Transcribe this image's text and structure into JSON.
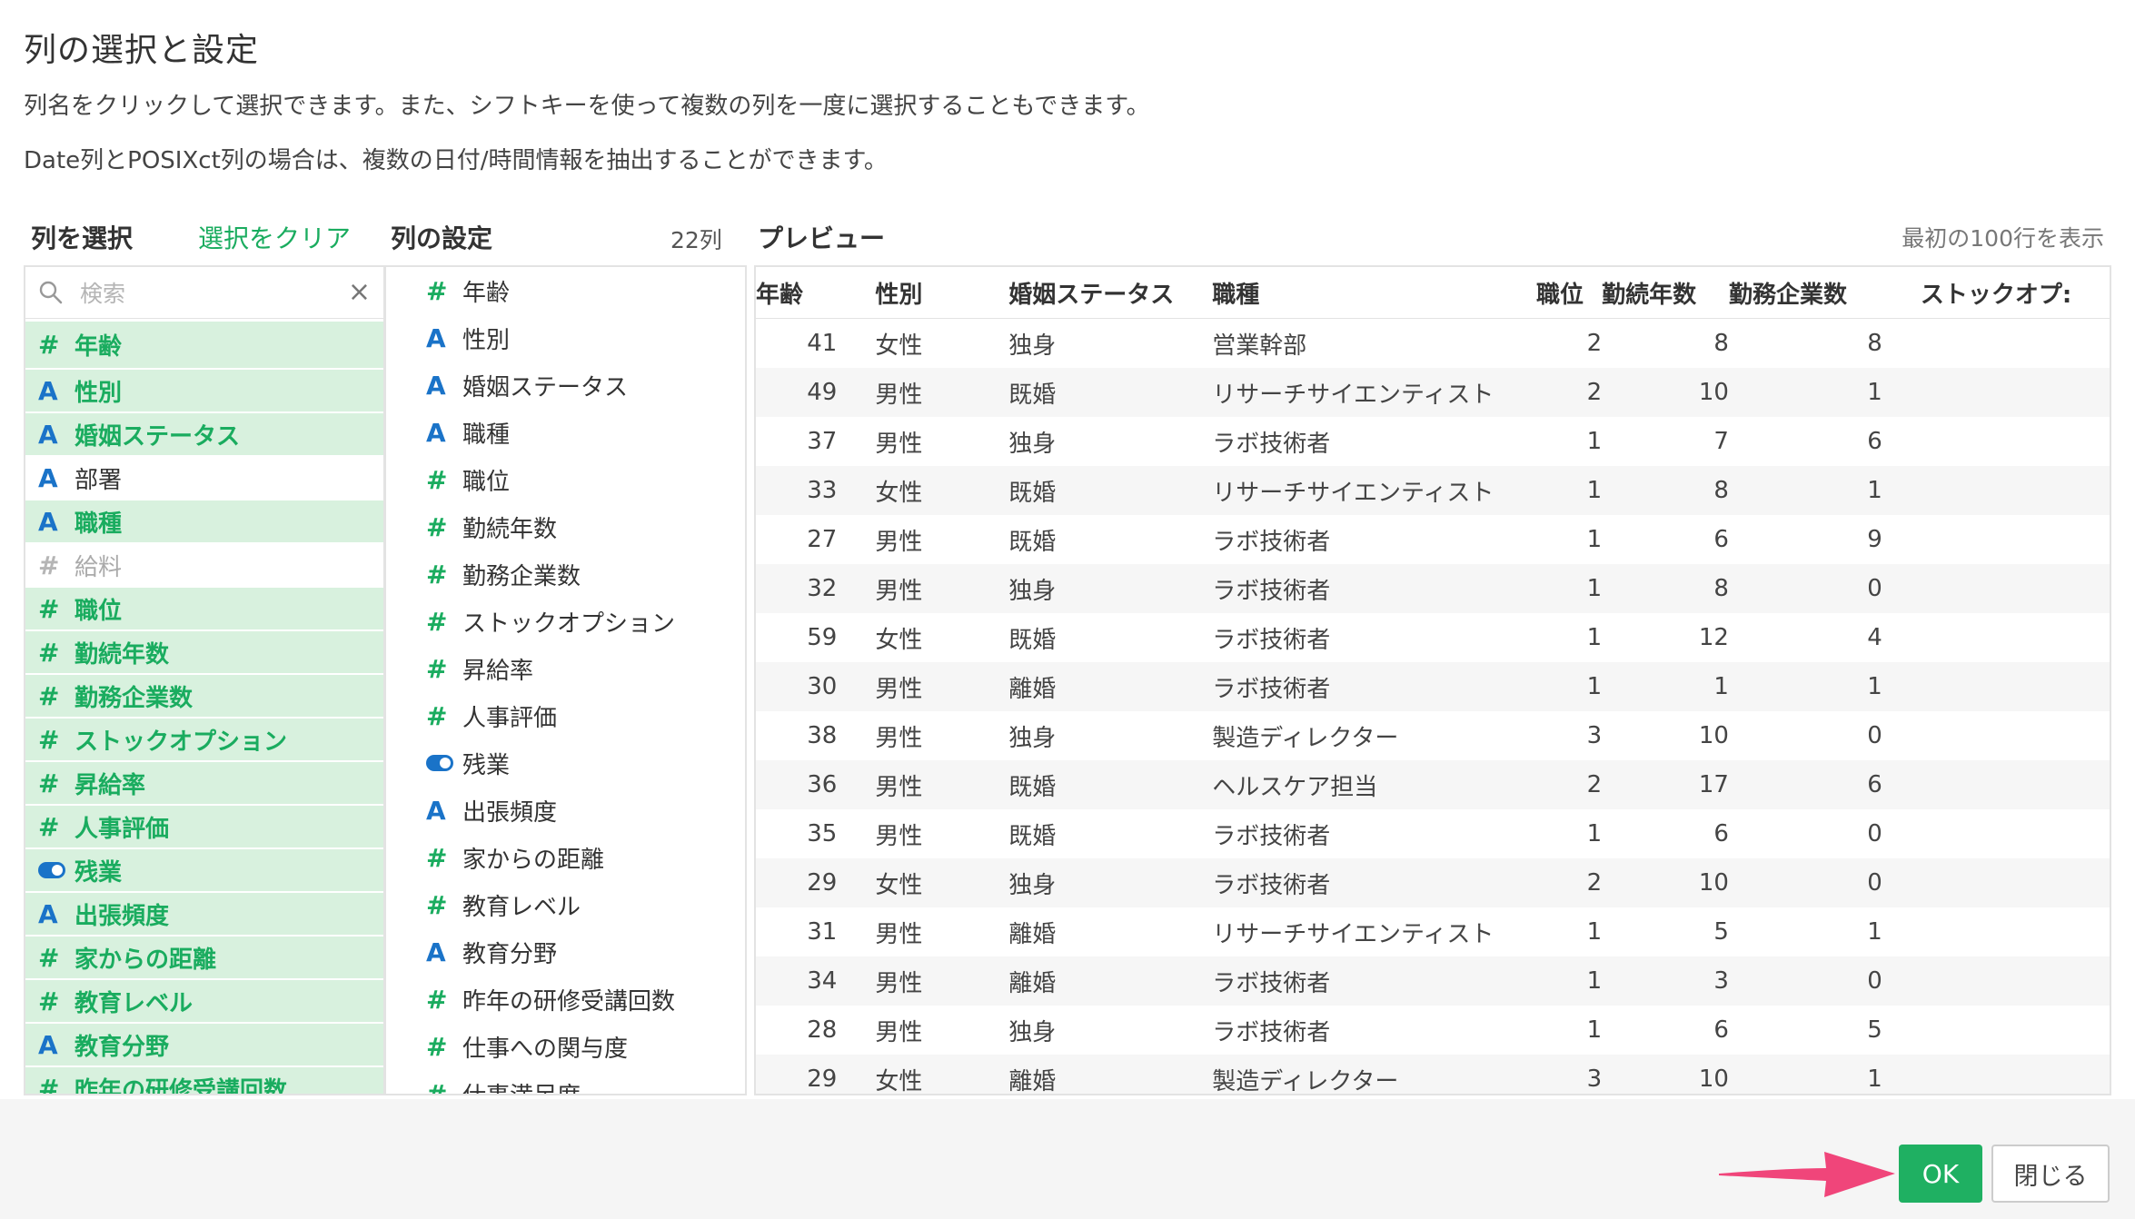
{
  "dialog": {
    "title": "列の選択と設定",
    "description1": "列名をクリックして選択できます。また、シフトキーを使って複数の列を一度に選択することもできます。",
    "description2": "Date列とPOSIXct列の場合は、複数の日付/時間情報を抽出することができます。"
  },
  "select_section": {
    "heading": "列を選択",
    "clear_label": "選択をクリア",
    "search_placeholder": "検索",
    "clear_icon": "×",
    "items": [
      {
        "type": "#",
        "label": "年齢",
        "state": "selected"
      },
      {
        "type": "A",
        "label": "性別",
        "state": "selected"
      },
      {
        "type": "A",
        "label": "婚姻ステータス",
        "state": "selected"
      },
      {
        "type": "A",
        "label": "部署",
        "state": "plain"
      },
      {
        "type": "A",
        "label": "職種",
        "state": "selected"
      },
      {
        "type": "#",
        "label": "給料",
        "state": "disabled"
      },
      {
        "type": "#",
        "label": "職位",
        "state": "selected"
      },
      {
        "type": "#",
        "label": "勤続年数",
        "state": "selected"
      },
      {
        "type": "#",
        "label": "勤務企業数",
        "state": "selected"
      },
      {
        "type": "#",
        "label": "ストックオプション",
        "state": "selected"
      },
      {
        "type": "#",
        "label": "昇給率",
        "state": "selected"
      },
      {
        "type": "#",
        "label": "人事評価",
        "state": "selected"
      },
      {
        "type": "toggle",
        "label": "残業",
        "state": "selected"
      },
      {
        "type": "A",
        "label": "出張頻度",
        "state": "selected"
      },
      {
        "type": "#",
        "label": "家からの距離",
        "state": "selected"
      },
      {
        "type": "#",
        "label": "教育レベル",
        "state": "selected"
      },
      {
        "type": "A",
        "label": "教育分野",
        "state": "selected"
      },
      {
        "type": "#",
        "label": "昨年の研修受講回数",
        "state": "selected"
      }
    ]
  },
  "settings_section": {
    "heading": "列の設定",
    "count_label": "22列",
    "items": [
      {
        "type": "#",
        "label": "年齢"
      },
      {
        "type": "A",
        "label": "性別"
      },
      {
        "type": "A",
        "label": "婚姻ステータス"
      },
      {
        "type": "A",
        "label": "職種"
      },
      {
        "type": "#",
        "label": "職位"
      },
      {
        "type": "#",
        "label": "勤続年数"
      },
      {
        "type": "#",
        "label": "勤務企業数"
      },
      {
        "type": "#",
        "label": "ストックオプション"
      },
      {
        "type": "#",
        "label": "昇給率"
      },
      {
        "type": "#",
        "label": "人事評価"
      },
      {
        "type": "toggle",
        "label": "残業"
      },
      {
        "type": "A",
        "label": "出張頻度"
      },
      {
        "type": "#",
        "label": "家からの距離"
      },
      {
        "type": "#",
        "label": "教育レベル"
      },
      {
        "type": "A",
        "label": "教育分野"
      },
      {
        "type": "#",
        "label": "昨年の研修受講回数"
      },
      {
        "type": "#",
        "label": "仕事への関与度"
      },
      {
        "type": "#",
        "label": "仕事満足度"
      }
    ]
  },
  "preview": {
    "heading": "プレビュー",
    "note": "最初の100行を表示",
    "columns": [
      "年齢",
      "性別",
      "婚姻ステータス",
      "職種",
      "職位",
      "勤続年数",
      "勤務企業数",
      "ストックオプ:"
    ],
    "rows": [
      [
        "41",
        "女性",
        "独身",
        "営業幹部",
        "2",
        "8",
        "8",
        ""
      ],
      [
        "49",
        "男性",
        "既婚",
        "リサーチサイエンティスト",
        "2",
        "10",
        "1",
        ""
      ],
      [
        "37",
        "男性",
        "独身",
        "ラボ技術者",
        "1",
        "7",
        "6",
        ""
      ],
      [
        "33",
        "女性",
        "既婚",
        "リサーチサイエンティスト",
        "1",
        "8",
        "1",
        ""
      ],
      [
        "27",
        "男性",
        "既婚",
        "ラボ技術者",
        "1",
        "6",
        "9",
        ""
      ],
      [
        "32",
        "男性",
        "独身",
        "ラボ技術者",
        "1",
        "8",
        "0",
        ""
      ],
      [
        "59",
        "女性",
        "既婚",
        "ラボ技術者",
        "1",
        "12",
        "4",
        ""
      ],
      [
        "30",
        "男性",
        "離婚",
        "ラボ技術者",
        "1",
        "1",
        "1",
        ""
      ],
      [
        "38",
        "男性",
        "独身",
        "製造ディレクター",
        "3",
        "10",
        "0",
        ""
      ],
      [
        "36",
        "男性",
        "既婚",
        "ヘルスケア担当",
        "2",
        "17",
        "6",
        ""
      ],
      [
        "35",
        "男性",
        "既婚",
        "ラボ技術者",
        "1",
        "6",
        "0",
        ""
      ],
      [
        "29",
        "女性",
        "独身",
        "ラボ技術者",
        "2",
        "10",
        "0",
        ""
      ],
      [
        "31",
        "男性",
        "離婚",
        "リサーチサイエンティスト",
        "1",
        "5",
        "1",
        ""
      ],
      [
        "34",
        "男性",
        "離婚",
        "ラボ技術者",
        "1",
        "3",
        "0",
        ""
      ],
      [
        "28",
        "男性",
        "独身",
        "ラボ技術者",
        "1",
        "6",
        "5",
        ""
      ],
      [
        "29",
        "女性",
        "離婚",
        "製造ディレクター",
        "3",
        "10",
        "1",
        ""
      ]
    ]
  },
  "footer": {
    "ok_label": "OK",
    "close_label": "閉じる"
  },
  "colors": {
    "accent_green": "#1fb062",
    "selected_bg": "#d8f1de",
    "type_A_blue": "#1a73c8",
    "arrow_pink": "#f0457a"
  }
}
